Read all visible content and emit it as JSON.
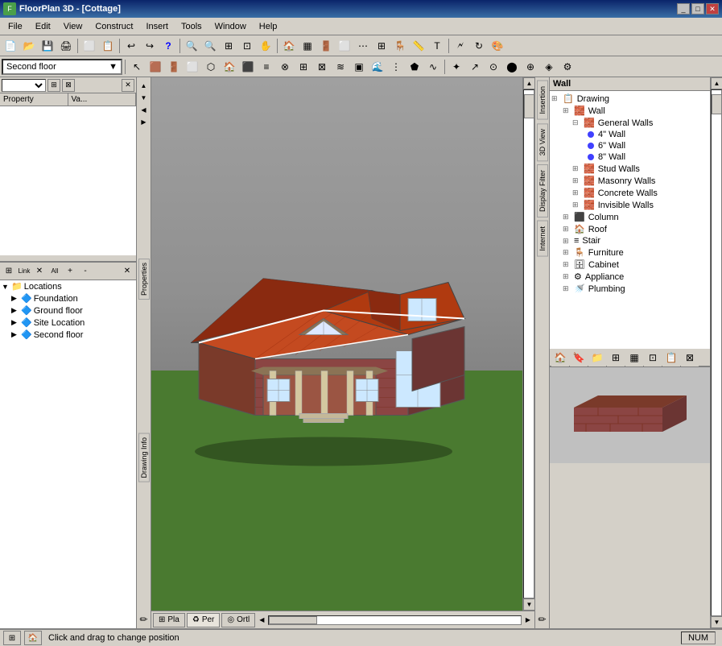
{
  "window": {
    "title": "FloorPlan 3D - [Cottage]"
  },
  "menu": {
    "items": [
      "File",
      "Edit",
      "View",
      "Construct",
      "Insert",
      "Tools",
      "Window",
      "Help"
    ]
  },
  "floor_selector": {
    "label": "Second floor",
    "options": [
      "Foundation",
      "Ground floor",
      "Site Location",
      "Second floor"
    ]
  },
  "properties_panel": {
    "col1": "Property",
    "col2": "Va..."
  },
  "tree_toolbar": {
    "link": "Link",
    "all": "All"
  },
  "tree_items": [
    {
      "label": "Locations",
      "level": 0,
      "expanded": true
    },
    {
      "label": "Foundation",
      "level": 1,
      "expanded": false
    },
    {
      "label": "Ground floor",
      "level": 1,
      "expanded": false
    },
    {
      "label": "Site Location",
      "level": 1,
      "expanded": false
    },
    {
      "label": "Second floor",
      "level": 1,
      "expanded": false
    }
  ],
  "side_tabs": {
    "properties": "Properties",
    "insertion": "Insertion",
    "three_d_view": "3D View",
    "display_filter": "Display Filter",
    "internet": "Internet",
    "drawing_info": "Drawing Info"
  },
  "object_panel": {
    "title": "Wall",
    "tree": [
      {
        "label": "Drawing",
        "level": 0,
        "type": "folder",
        "expanded": true
      },
      {
        "label": "Wall",
        "level": 1,
        "type": "folder",
        "expanded": true
      },
      {
        "label": "General Walls",
        "level": 2,
        "type": "folder",
        "expanded": true
      },
      {
        "label": "4\" Wall",
        "level": 3,
        "type": "dot"
      },
      {
        "label": "6\" Wall",
        "level": 3,
        "type": "dot"
      },
      {
        "label": "8\" Wall",
        "level": 3,
        "type": "dot"
      },
      {
        "label": "Stud Walls",
        "level": 2,
        "type": "folder"
      },
      {
        "label": "Masonry Walls",
        "level": 2,
        "type": "folder"
      },
      {
        "label": "Concrete Walls",
        "level": 2,
        "type": "folder"
      },
      {
        "label": "Invisible Walls",
        "level": 2,
        "type": "folder"
      },
      {
        "label": "Column",
        "level": 1,
        "type": "folder"
      },
      {
        "label": "Roof",
        "level": 1,
        "type": "folder"
      },
      {
        "label": "Stair",
        "level": 1,
        "type": "folder"
      },
      {
        "label": "Furniture",
        "level": 1,
        "type": "folder"
      },
      {
        "label": "Cabinet",
        "level": 1,
        "type": "folder"
      },
      {
        "label": "Appliance",
        "level": 1,
        "type": "folder"
      },
      {
        "label": "Plumbing",
        "level": 1,
        "type": "folder"
      }
    ]
  },
  "view_tabs": [
    {
      "label": "Pla",
      "icon": "grid"
    },
    {
      "label": "Per",
      "icon": "cube"
    },
    {
      "label": "Ortl",
      "icon": "ortho"
    }
  ],
  "status": {
    "text": "Click and drag to change position",
    "num": "NUM"
  }
}
